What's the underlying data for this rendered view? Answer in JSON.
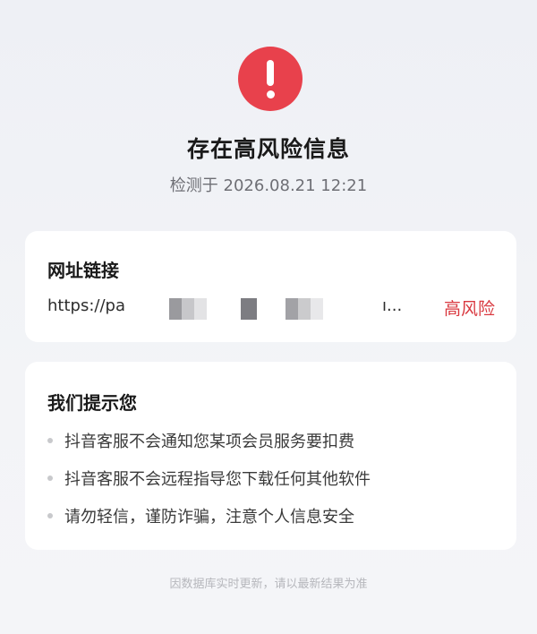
{
  "header": {
    "alert_icon": "exclamation-circle-icon",
    "alert_color": "#e8414c",
    "title": "存在高风险信息",
    "detected_at": "检测于 2026.08.21 12:21"
  },
  "url_card": {
    "title": "网址链接",
    "url_prefix": "https://pa",
    "url_suffix": "ı...",
    "risk_label": "高风险",
    "risk_color": "#d9383f"
  },
  "tips_card": {
    "title": "我们提示您",
    "items": [
      "抖音客服不会通知您某项会员服务要扣费",
      "抖音客服不会远程指导您下载任何其他软件",
      "请勿轻信，谨防诈骗，注意个人信息安全"
    ]
  },
  "footer": {
    "note": "因数据库实时更新，请以最新结果为准"
  }
}
